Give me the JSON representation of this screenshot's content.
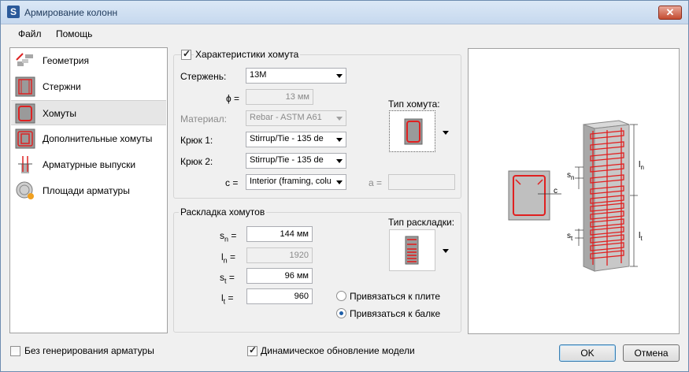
{
  "window": {
    "title": "Армирование колонн",
    "app_icon_letter": "S",
    "close_glyph": "✕"
  },
  "menu": {
    "file": "Файл",
    "help": "Помощь"
  },
  "sidebar": {
    "items": [
      {
        "label": "Геометрия",
        "icon": "geometry-icon"
      },
      {
        "label": "Стержни",
        "icon": "bars-icon"
      },
      {
        "label": "Хомуты",
        "icon": "stirrups-icon",
        "selected": true
      },
      {
        "label": "Дополнительные хомуты",
        "icon": "additional-stirrups-icon"
      },
      {
        "label": "Арматурные выпуски",
        "icon": "dowels-icon"
      },
      {
        "label": "Площади арматуры",
        "icon": "reinforcement-areas-icon"
      }
    ]
  },
  "stirrup_props": {
    "title": "Характеристики хомута",
    "checked": true,
    "bar_label": "Стержень:",
    "bar_value": "13M",
    "phi_label": "ϕ =",
    "phi_value": "13 мм",
    "material_label": "Материал:",
    "material_value": "Rebar - ASTM A61",
    "hook1_label": "Крюк 1:",
    "hook1_value": "Stirrup/Tie - 135 de",
    "hook2_label": "Крюк 2:",
    "hook2_value": "Stirrup/Tie - 135 de",
    "c_label": "c =",
    "c_value": "Interior (framing, colum",
    "a_label": "a =",
    "a_value": "",
    "type_label": "Тип хомута:"
  },
  "layout": {
    "title": "Раскладка хомутов",
    "sn_label": "s",
    "sn_sub": "n",
    "sn_value": "144 мм",
    "ln_label": "l",
    "ln_sub": "n",
    "ln_value": "1920",
    "st_label": "s",
    "st_sub": "t",
    "st_value": "96 мм",
    "lt_label": "l",
    "lt_sub": "t",
    "lt_value": "960",
    "eq": "=",
    "type_label": "Тип раскладки:",
    "snap_slab": "Привязаться к плите",
    "snap_beam": "Привязаться к балке",
    "selected_snap": "beam"
  },
  "preview": {
    "c": "c",
    "sn": "s",
    "sn_sub": "n",
    "st": "s",
    "st_sub": "t",
    "ln": "l",
    "ln_sub": "n",
    "lt": "l",
    "lt_sub": "t"
  },
  "footer": {
    "no_generation": "Без генерирования арматуры",
    "no_generation_checked": false,
    "dynamic_update": "Динамическое обновление модели",
    "dynamic_update_checked": true,
    "ok": "OK",
    "cancel": "Отмена"
  },
  "colors": {
    "rebar_red": "#e02020",
    "concrete_gray": "#bfbfbf",
    "title_text": "#1e395b"
  }
}
